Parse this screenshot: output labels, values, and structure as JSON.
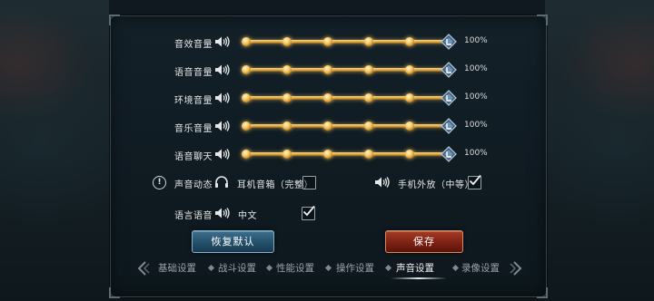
{
  "sliders": [
    {
      "label": "音效音量",
      "value": "100%",
      "level": 1.0
    },
    {
      "label": "语音音量",
      "value": "100%",
      "level": 1.0
    },
    {
      "label": "环境音量",
      "value": "100%",
      "level": 1.0
    },
    {
      "label": "音乐音量",
      "value": "100%",
      "level": 1.0
    },
    {
      "label": "语音聊天",
      "value": "100%",
      "level": 1.0
    }
  ],
  "options": {
    "dynamic_label": "声音动态",
    "headphone_label": "耳机音箱（完整）",
    "headphone_checked": false,
    "phone_label": "手机外放（中等）",
    "phone_checked": true,
    "language_label": "语言语音",
    "language_value": "中文",
    "language_checked": true
  },
  "buttons": {
    "restore": "恢复默认",
    "save": "保存"
  },
  "tabs": [
    {
      "label": "基础设置",
      "active": false
    },
    {
      "label": "战斗设置",
      "active": false
    },
    {
      "label": "性能设置",
      "active": false
    },
    {
      "label": "操作设置",
      "active": false
    },
    {
      "label": "声音设置",
      "active": true
    },
    {
      "label": "录像设置",
      "active": false
    }
  ],
  "icons": {
    "speaker": "speaker-icon",
    "headphone": "headphone-icon",
    "info": "info-icon",
    "check": "check-icon"
  },
  "colors": {
    "slider_gold": "#e2ae48",
    "thumb_blue": "#5b7fa0",
    "restore_button": "#2f6080",
    "save_button": "#8c2a18"
  }
}
